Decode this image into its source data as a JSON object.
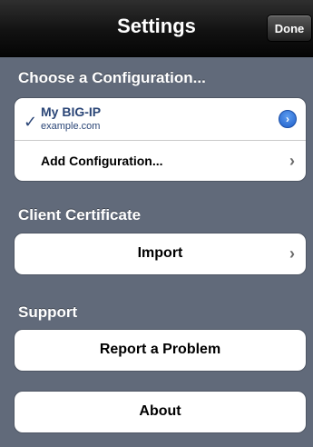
{
  "nav": {
    "title": "Settings",
    "done_label": "Done"
  },
  "sections": {
    "configuration": {
      "header": "Choose a Configuration...",
      "current": {
        "name": "My BIG-IP",
        "host": "example.com",
        "check_icon": "checkmark-icon",
        "detail_icon": "detail-disclosure-icon"
      },
      "add_label": "Add Configuration..."
    },
    "certificate": {
      "header": "Client Certificate",
      "import_label": "Import"
    },
    "support": {
      "header": "Support",
      "report_label": "Report a Problem",
      "about_label": "About"
    }
  },
  "colors": {
    "background": "#616a7a",
    "accent_text": "#2b4677",
    "nav_bar": "#121212"
  }
}
